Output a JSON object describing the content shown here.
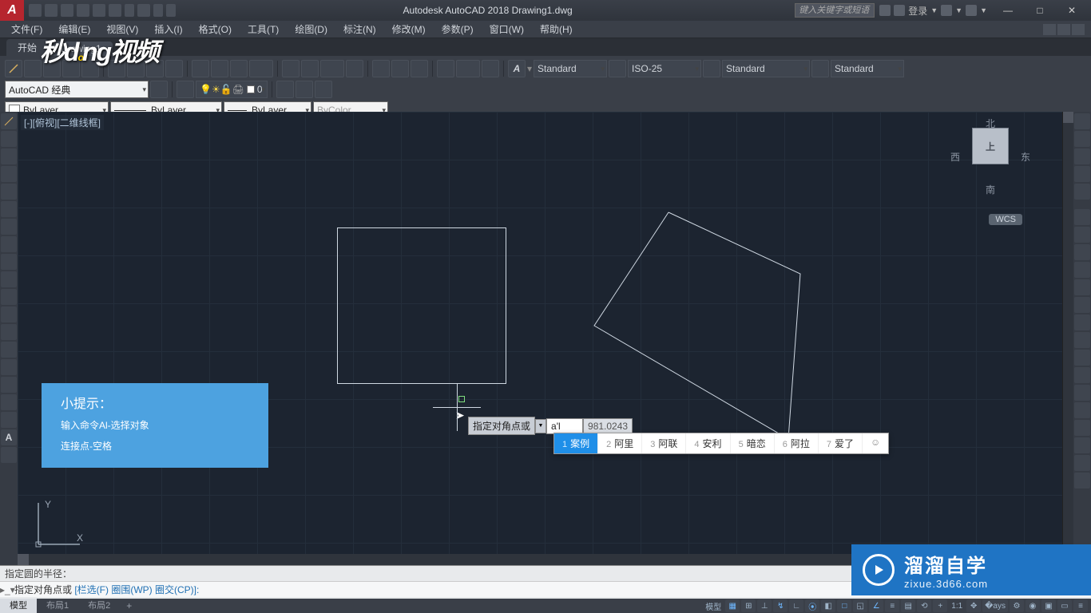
{
  "app": {
    "title": "Autodesk AutoCAD 2018   Drawing1.dwg",
    "search_placeholder": "键入关键字或短语",
    "login": "登录"
  },
  "menu": [
    "文件(F)",
    "编辑(E)",
    "视图(V)",
    "插入(I)",
    "格式(O)",
    "工具(T)",
    "绘图(D)",
    "标注(N)",
    "修改(M)",
    "参数(P)",
    "窗口(W)",
    "帮助(H)"
  ],
  "tabs": {
    "start": "开始",
    "doc": "Drawing1"
  },
  "ribbon": {
    "text_style": "Standard",
    "dim_style": "ISO-25",
    "table_style": "Standard",
    "mleader_style": "Standard"
  },
  "workspace_combo": "AutoCAD 经典",
  "layer_state": "0",
  "props": {
    "color": "ByLayer",
    "linetype": "ByLayer",
    "lineweight": "ByLayer",
    "plotstyle": "ByColor"
  },
  "viewport_label": "[-][俯视][二维线框]",
  "viewcube": {
    "n": "北",
    "s": "南",
    "e": "东",
    "w": "西",
    "top": "上",
    "wcs": "WCS"
  },
  "dyn": {
    "prompt": "指定对角点或",
    "input_value": "a'l",
    "coord": "981.0243"
  },
  "ime": {
    "items": [
      "案例",
      "阿里",
      "阿联",
      "安利",
      "暗恋",
      "阿拉",
      "爱了"
    ]
  },
  "tip": {
    "title": "小提示：",
    "line1": "输入命令Al-选择对象",
    "line2": "连接点-空格"
  },
  "cmd": {
    "history": "指定圆的半径：",
    "prompt_prefix": "指定对角点或",
    "options_raw": " [栏选(F) 圈围(WP) 圈交(CP)]:"
  },
  "layout_tabs": [
    "模型",
    "布局1",
    "布局2"
  ],
  "status": {
    "model": "模型",
    "scale": "1:1",
    "extra": ""
  },
  "watermark": {
    "cn": "溜溜自学",
    "en": "zixue.3d66.com"
  }
}
